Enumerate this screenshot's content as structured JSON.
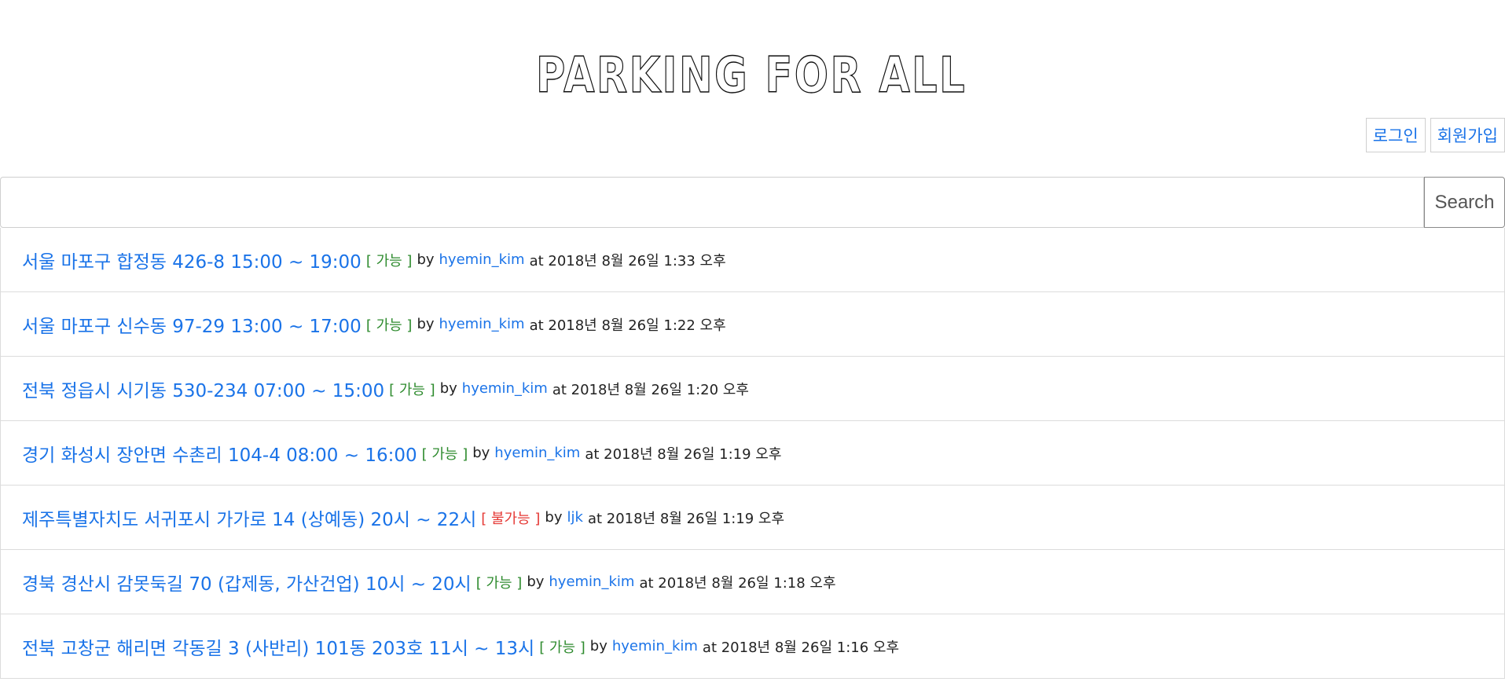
{
  "brand": {
    "logo_text": "PARKING FOR ALL"
  },
  "auth": {
    "login_label": "로그인",
    "signup_label": "회원가입"
  },
  "search": {
    "value": "",
    "placeholder": "",
    "button_label": "Search"
  },
  "posts": [
    {
      "title": "서울 마포구 합정동 426-8 15:00 ~ 19:00",
      "status": "[ 가능 ]",
      "status_type": "ok",
      "by": "by",
      "user": "hyemin_kim",
      "at": "at 2018년 8월 26일 1:33 오후"
    },
    {
      "title": "서울 마포구 신수동 97-29 13:00 ~ 17:00",
      "status": "[ 가능 ]",
      "status_type": "ok",
      "by": "by",
      "user": "hyemin_kim",
      "at": "at 2018년 8월 26일 1:22 오후"
    },
    {
      "title": "전북 정읍시 시기동 530-234 07:00 ~ 15:00",
      "status": "[ 가능 ]",
      "status_type": "ok",
      "by": "by",
      "user": "hyemin_kim",
      "at": "at 2018년 8월 26일 1:20 오후"
    },
    {
      "title": "경기 화성시 장안면 수촌리 104-4 08:00 ~ 16:00",
      "status": "[ 가능 ]",
      "status_type": "ok",
      "by": "by",
      "user": "hyemin_kim",
      "at": "at 2018년 8월 26일 1:19 오후"
    },
    {
      "title": "제주특별자치도 서귀포시 가가로 14 (상예동) 20시 ~ 22시",
      "status": "[ 불가능 ]",
      "status_type": "no",
      "by": "by",
      "user": "ljk",
      "at": "at 2018년 8월 26일 1:19 오후"
    },
    {
      "title": "경북 경산시 감못둑길 70 (갑제동, 가산건업) 10시 ~ 20시",
      "status": "[ 가능 ]",
      "status_type": "ok",
      "by": "by",
      "user": "hyemin_kim",
      "at": "at 2018년 8월 26일 1:18 오후"
    },
    {
      "title": "전북 고창군 해리면 각동길 3 (사반리) 101동 203호 11시 ~ 13시",
      "status": "[ 가능 ]",
      "status_type": "ok",
      "by": "by",
      "user": "hyemin_kim",
      "at": "at 2018년 8월 26일 1:16 오후"
    }
  ],
  "colors": {
    "link": "#1a73e8",
    "available": "#2e8b2e",
    "unavailable": "#e53935"
  }
}
